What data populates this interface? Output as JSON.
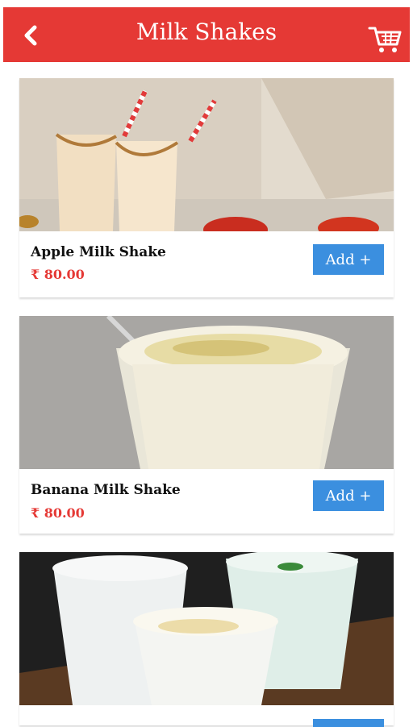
{
  "header": {
    "title": "Milk Shakes",
    "back_icon": "chevron-left-icon",
    "cart_icon": "cart-icon",
    "color": "#e53935"
  },
  "products": [
    {
      "name": "Apple Milk Shake",
      "price": "₹ 80.00",
      "add_label": "Add +"
    },
    {
      "name": "Banana Milk Shake",
      "price": "₹ 80.00",
      "add_label": "Add +"
    },
    {
      "name": "",
      "price": "",
      "add_label": ""
    }
  ],
  "colors": {
    "accent_red": "#e53935",
    "button_blue": "#3b8fdf"
  }
}
